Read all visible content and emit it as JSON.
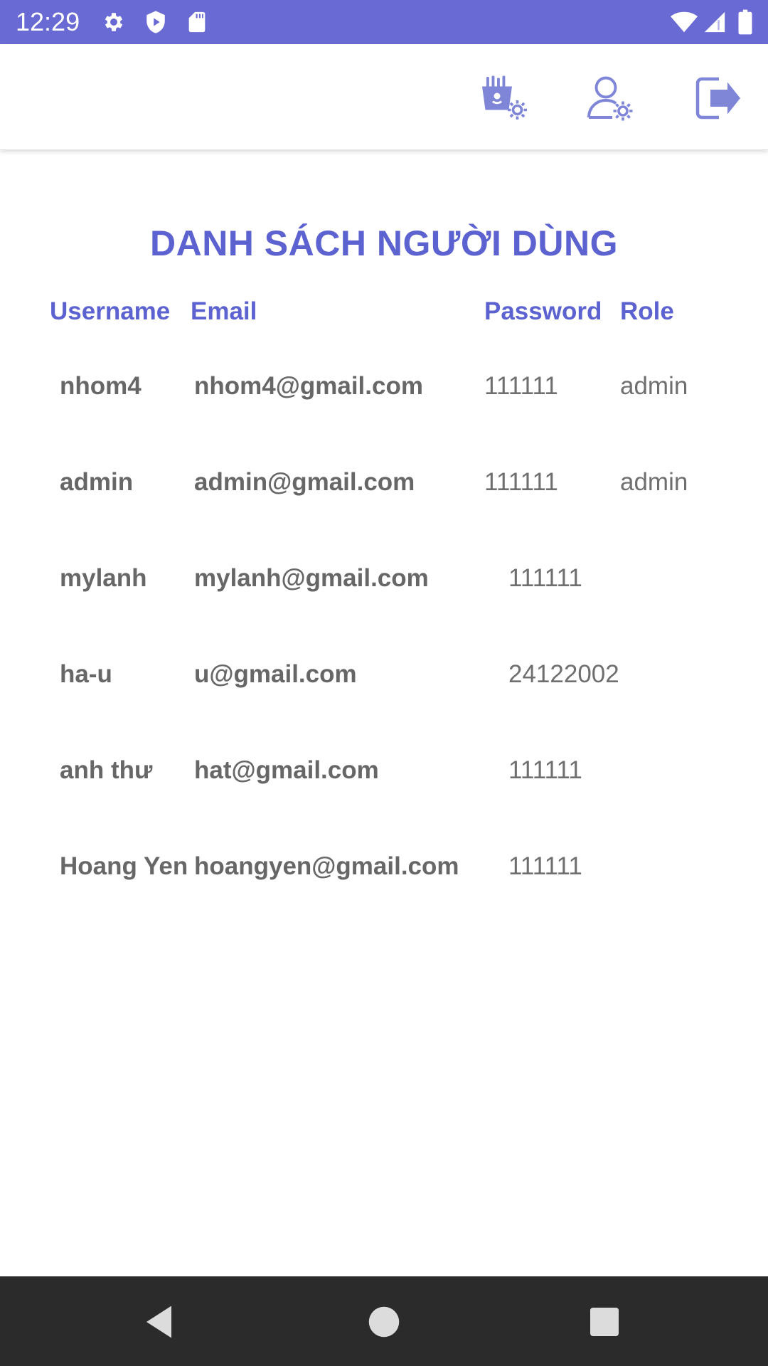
{
  "status_bar": {
    "time": "12:29",
    "icons": [
      "settings-icon",
      "shield-play-icon",
      "sd-card-icon",
      "wifi-icon",
      "signal-icon",
      "battery-icon"
    ]
  },
  "app_bar": {
    "actions": [
      "food-settings-icon",
      "user-settings-icon",
      "logout-icon"
    ]
  },
  "page": {
    "title": "DANH SÁCH NGƯỜI DÙNG"
  },
  "table": {
    "columns": [
      "Username",
      "Email",
      "Password",
      "Role"
    ],
    "rows": [
      {
        "username": "nhom4",
        "email": "nhom4@gmail.com",
        "password": "111111",
        "role": "admin"
      },
      {
        "username": "admin",
        "email": "admin@gmail.com",
        "password": "111111",
        "role": "admin"
      },
      {
        "username": "mylanh",
        "email": "mylanh@gmail.com",
        "password": "111111",
        "role": ""
      },
      {
        "username": "ha-u",
        "email": "u@gmail.com",
        "password": "24122002",
        "role": ""
      },
      {
        "username": "anh thư",
        "email": "hat@gmail.com",
        "password": "111111",
        "role": ""
      },
      {
        "username": "Hoang Yen",
        "email": "hoangyen@gmail.com",
        "password": "111111",
        "role": ""
      }
    ]
  },
  "nav_bar": {
    "buttons": [
      "back-icon",
      "home-icon",
      "recents-icon"
    ]
  },
  "colors": {
    "accent": "#5c62cf",
    "status_bar": "#6a6ad4",
    "icon_tint": "#7f86d8",
    "text_gray": "#676767",
    "nav_bar": "#2b2b2b"
  }
}
